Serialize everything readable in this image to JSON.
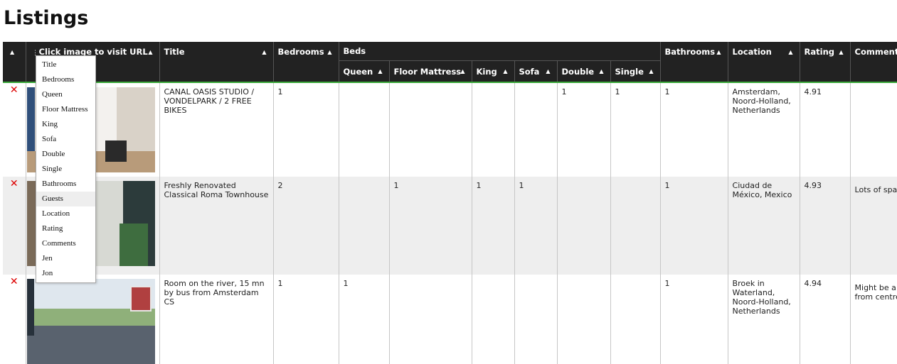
{
  "page_title": "Listings",
  "headers": {
    "url": "Click image to visit URL",
    "title": "Title",
    "bedrooms": "Bedrooms",
    "beds": "Beds",
    "queen": "Queen",
    "floor_mattress": "Floor Mattress",
    "king": "King",
    "sofa": "Sofa",
    "double": "Double",
    "single": "Single",
    "bathrooms": "Bathrooms",
    "location": "Location",
    "rating": "Rating",
    "comments": "Comments"
  },
  "sort_glyph": "▲",
  "delete_glyph": "✕",
  "menu_handle": "⋮",
  "column_menu": [
    "Title",
    "Bedrooms",
    "Queen",
    "Floor Mattress",
    "King",
    "Sofa",
    "Double",
    "Single",
    "Bathrooms",
    "Guests",
    "Location",
    "Rating",
    "Comments",
    "Jen",
    "Jon"
  ],
  "rows": [
    {
      "title": "CANAL OASIS STUDIO / VONDELPARK / 2 FREE BIKES",
      "bedrooms": "1",
      "queen": "",
      "floor_mattress": "",
      "king": "",
      "sofa": "",
      "double": "1",
      "single": "1",
      "bathrooms": "1",
      "location": "Amsterdam, Noord-Holland, Netherlands",
      "rating": "4.91",
      "comments": ""
    },
    {
      "title": "Freshly Renovated Classical Roma Townhouse",
      "bedrooms": "2",
      "queen": "",
      "floor_mattress": "1",
      "king": "1",
      "sofa": "1",
      "double": "",
      "single": "",
      "bathrooms": "1",
      "location": "Ciudad de México, Mexico",
      "rating": "4.93",
      "comments": "Lots of space"
    },
    {
      "title": "Room on the river, 15 mn by bus from Amsterdam CS",
      "bedrooms": "1",
      "queen": "1",
      "floor_mattress": "",
      "king": "",
      "sofa": "",
      "double": "",
      "single": "",
      "bathrooms": "1",
      "location": "Broek in Waterland, Noord-Holland, Netherlands",
      "rating": "4.94",
      "comments": "Might be a bit far from centre :("
    }
  ]
}
